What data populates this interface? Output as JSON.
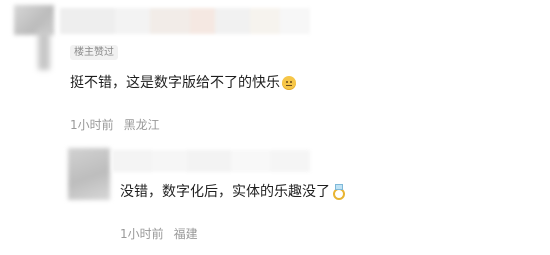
{
  "comments": [
    {
      "badge": "楼主赞过",
      "text": "挺不错，这是数字版给不了的快乐",
      "emoji": "smile-face-icon",
      "time": "1小时前",
      "location": "黑龙江"
    },
    {
      "text": "没错，数字化后，实体的乐趣没了",
      "emoji": "ring-icon",
      "time": "1小时前",
      "location": "福建"
    }
  ]
}
